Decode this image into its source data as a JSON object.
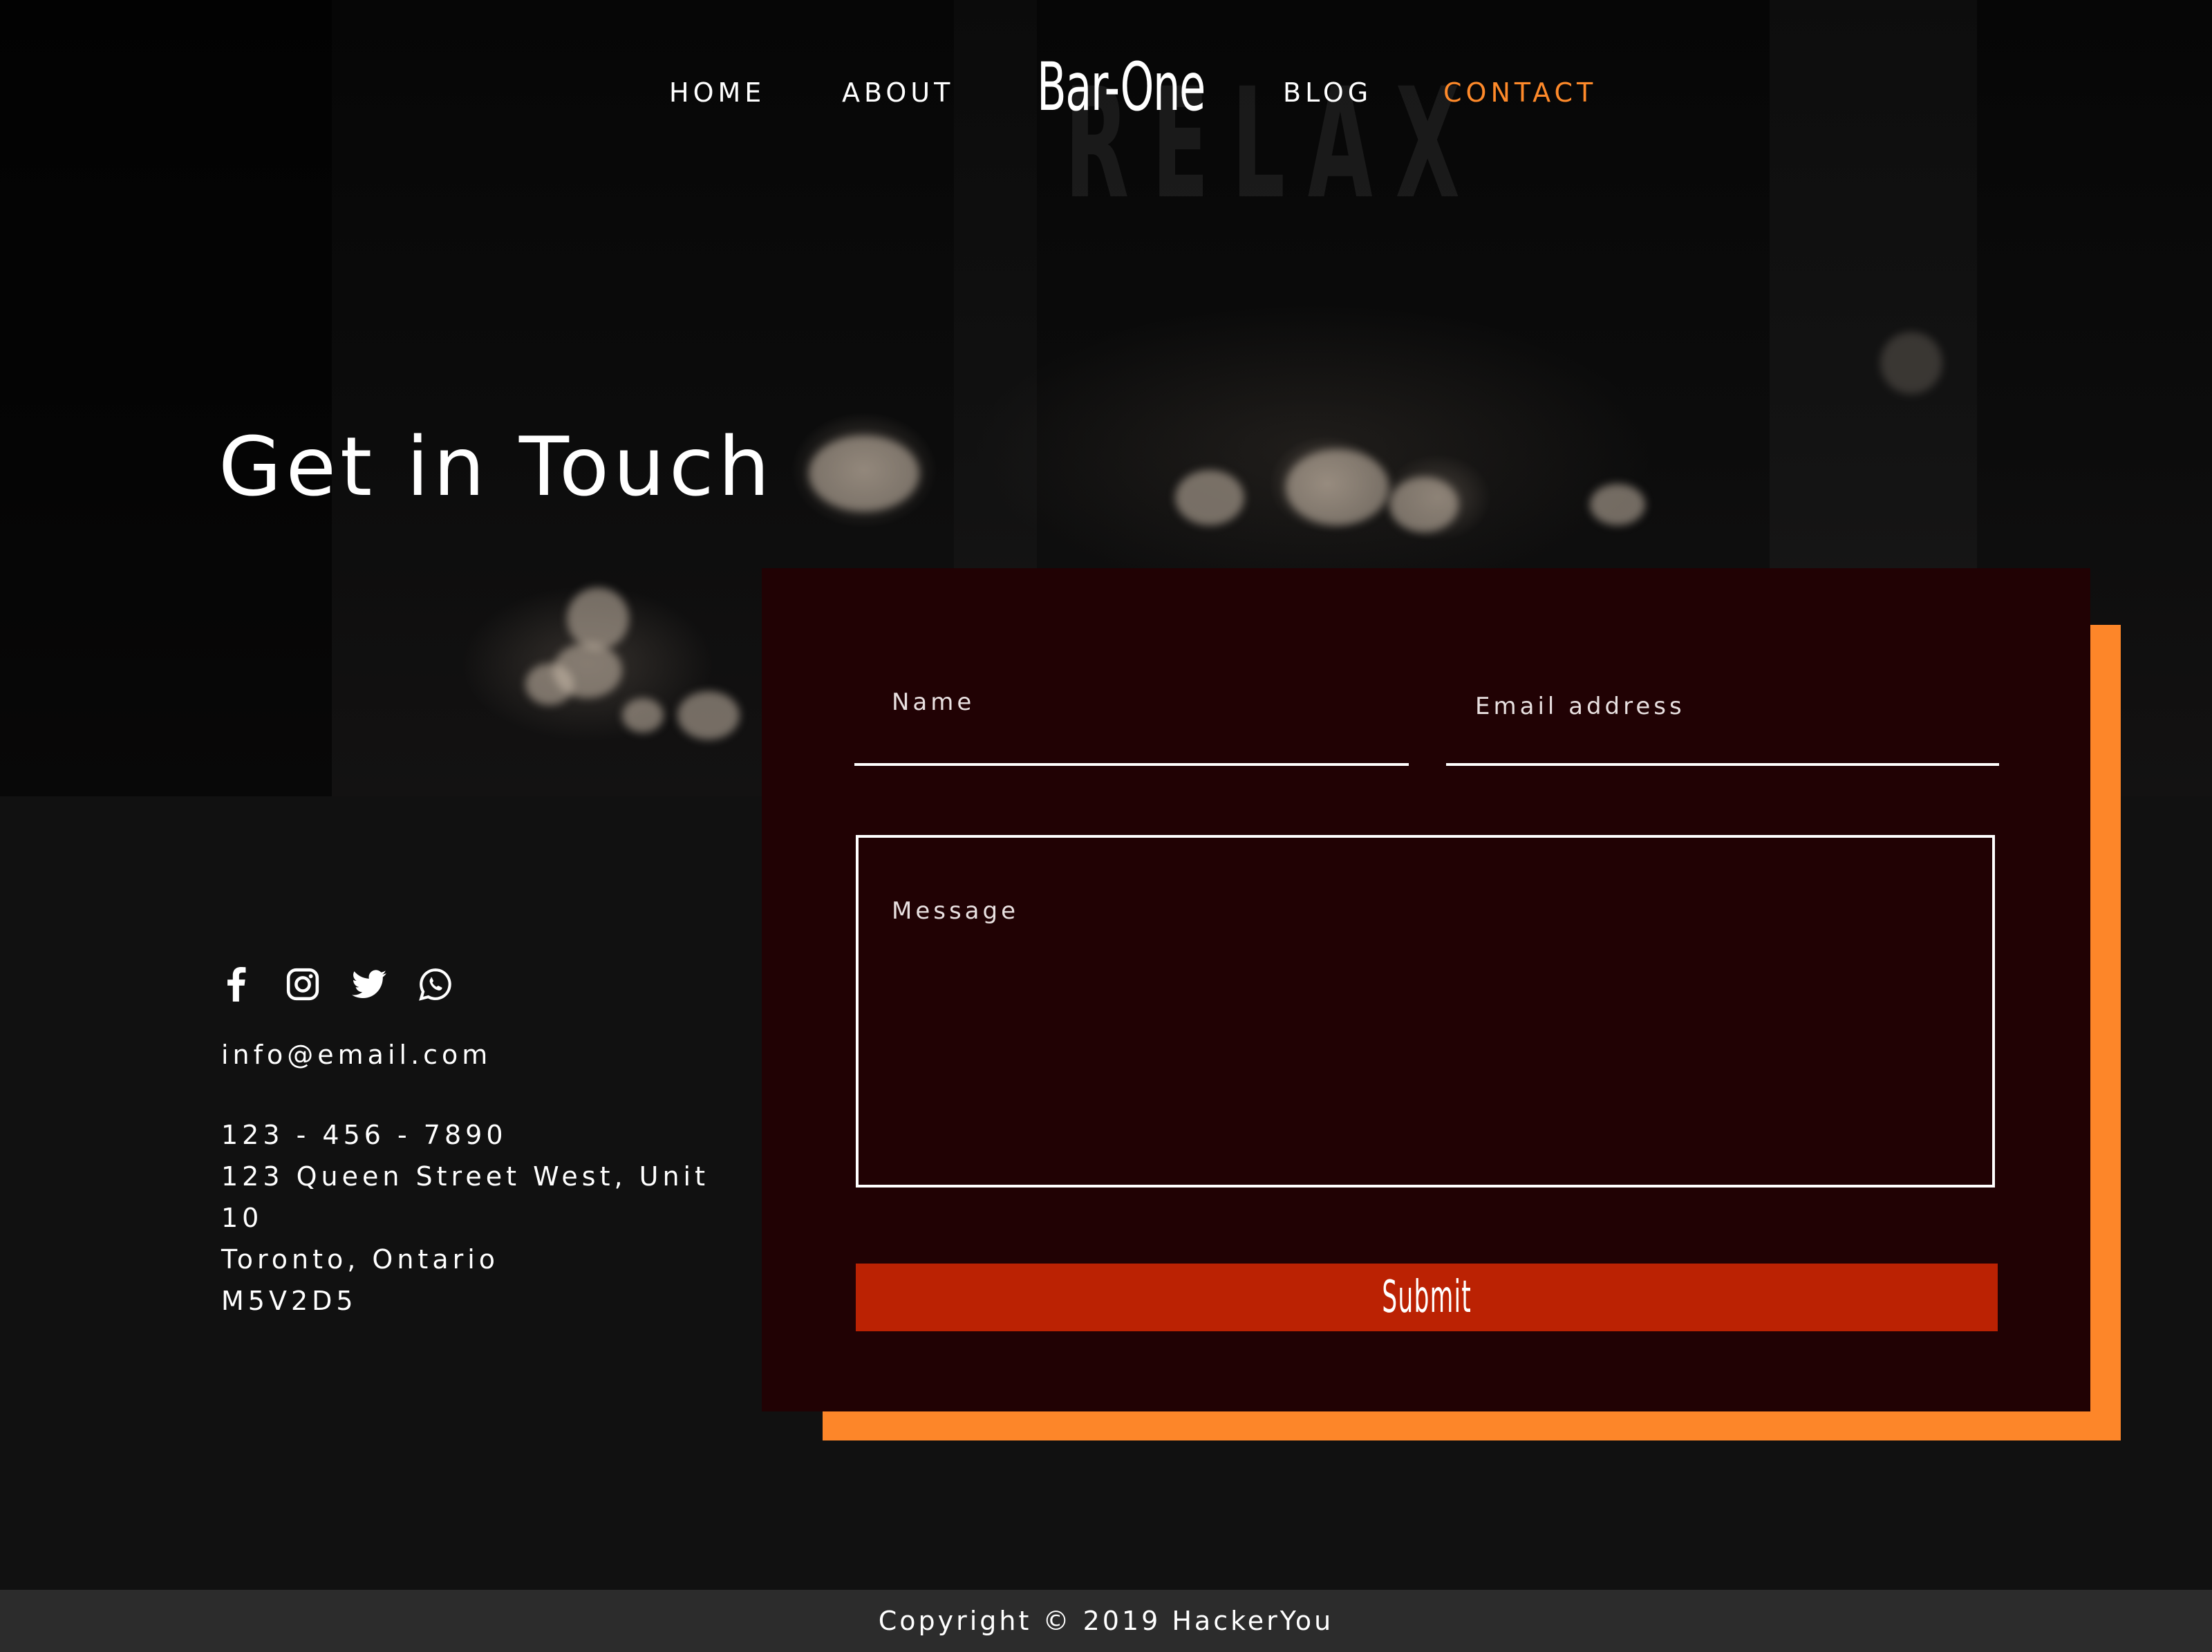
{
  "nav": {
    "items": [
      {
        "label": "HOME",
        "active": false
      },
      {
        "label": "ABOUT",
        "active": false
      },
      {
        "label": "BLOG",
        "active": false
      },
      {
        "label": "CONTACT",
        "active": true
      }
    ],
    "logo": "Bar-One",
    "active_color": "#ff8a2a"
  },
  "hero": {
    "background_sign": "RELAX",
    "title": "Get in Touch"
  },
  "contact": {
    "social_icons": [
      "facebook-icon",
      "instagram-icon",
      "twitter-icon",
      "whatsapp-icon"
    ],
    "email": "info@email.com",
    "phone": "123 - 456 - 7890",
    "address_lines": [
      "123 Queen Street West, Unit",
      "10",
      "Toronto, Ontario",
      "M5V2D5"
    ]
  },
  "form": {
    "name_label": "Name",
    "email_label": "Email address",
    "message_label": "Message",
    "name_value": "",
    "email_value": "",
    "message_value": "",
    "submit_label": "Submit",
    "card_color": "#210204",
    "accent_color": "#fd8629",
    "submit_color": "#bb2203"
  },
  "footer": {
    "copyright": "Copyright © 2019 HackerYou"
  }
}
